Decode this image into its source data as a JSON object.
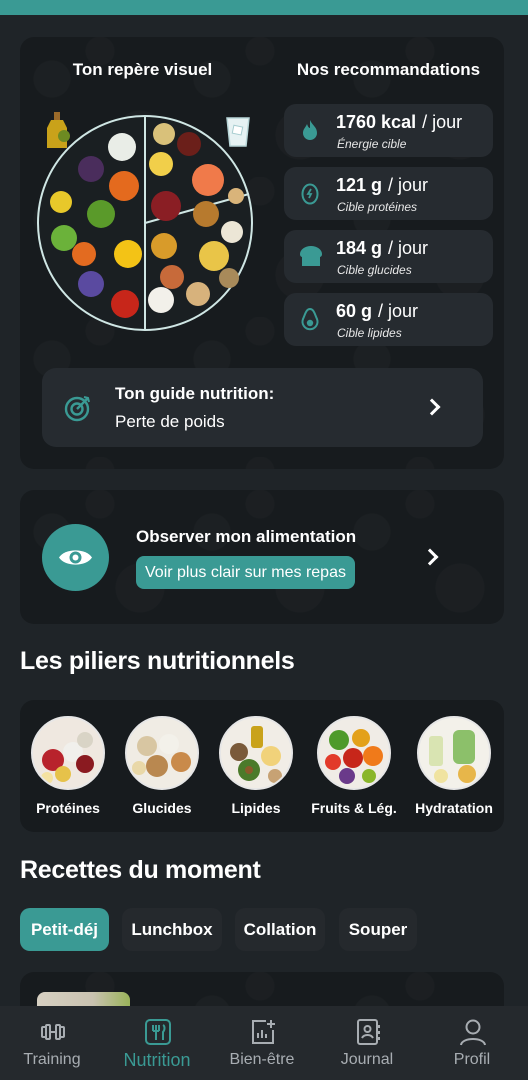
{
  "visual": {
    "left_title": "Ton repère visuel",
    "right_title": "Nos recommandations"
  },
  "recommendations": [
    {
      "icon": "flame-icon",
      "value": "1760 kcal",
      "unit": "/ jour",
      "label": "Énergie cible"
    },
    {
      "icon": "egg-icon",
      "value": "121 g",
      "unit": "/ jour",
      "label": "Cible protéines"
    },
    {
      "icon": "bread-icon",
      "value": "184 g",
      "unit": "/ jour",
      "label": "Cible glucides"
    },
    {
      "icon": "avocado-icon",
      "value": "60 g",
      "unit": "/ jour",
      "label": "Cible lipides"
    }
  ],
  "guide": {
    "title": "Ton guide nutrition:",
    "value": "Perte de poids"
  },
  "observe": {
    "title": "Observer mon alimentation",
    "button": "Voir plus clair sur mes repas"
  },
  "pillars": {
    "title": "Les piliers nutritionnels",
    "items": [
      {
        "label": "Protéines"
      },
      {
        "label": "Glucides"
      },
      {
        "label": "Lipides"
      },
      {
        "label": "Fruits & Lég."
      },
      {
        "label": "Hydratation"
      }
    ]
  },
  "recipes": {
    "title": "Recettes du moment",
    "chips": [
      "Petit-déj",
      "Lunchbox",
      "Collation",
      "Souper"
    ],
    "active": "Petit-déj"
  },
  "nav": {
    "items": [
      {
        "label": "Training",
        "icon": "dumbbell-icon"
      },
      {
        "label": "Nutrition",
        "icon": "cutlery-icon"
      },
      {
        "label": "Bien-être",
        "icon": "chart-plus-icon"
      },
      {
        "label": "Journal",
        "icon": "journal-icon"
      },
      {
        "label": "Profil",
        "icon": "user-icon"
      }
    ],
    "active": "Nutrition"
  },
  "colors": {
    "accent": "#3a9a94",
    "background": "#1f2428",
    "card": "#171b1e"
  }
}
